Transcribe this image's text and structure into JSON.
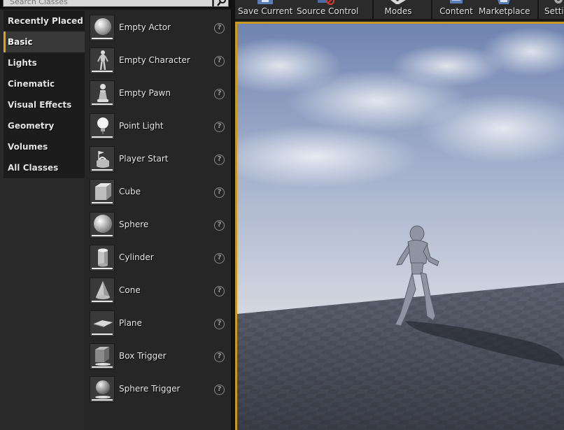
{
  "search": {
    "placeholder": "Search Classes"
  },
  "categories": [
    {
      "label": "Recently Placed"
    },
    {
      "label": "Basic",
      "active": true
    },
    {
      "label": "Lights"
    },
    {
      "label": "Cinematic"
    },
    {
      "label": "Visual Effects"
    },
    {
      "label": "Geometry"
    },
    {
      "label": "Volumes"
    },
    {
      "label": "All Classes"
    }
  ],
  "items": [
    {
      "label": "Empty Actor",
      "icon": "sphere-icon"
    },
    {
      "label": "Empty Character",
      "icon": "mannequin-icon"
    },
    {
      "label": "Empty Pawn",
      "icon": "pawn-icon"
    },
    {
      "label": "Point Light",
      "icon": "lightbulb-icon"
    },
    {
      "label": "Player Start",
      "icon": "player-start-icon"
    },
    {
      "label": "Cube",
      "icon": "cube-icon"
    },
    {
      "label": "Sphere",
      "icon": "sphere-icon"
    },
    {
      "label": "Cylinder",
      "icon": "cylinder-icon"
    },
    {
      "label": "Cone",
      "icon": "cone-icon"
    },
    {
      "label": "Plane",
      "icon": "plane-icon"
    },
    {
      "label": "Box Trigger",
      "icon": "box-trigger-icon"
    },
    {
      "label": "Sphere Trigger",
      "icon": "sphere-trigger-icon"
    }
  ],
  "help_glyph": "?",
  "toolbar": {
    "save_current": "Save Current",
    "source_control": "Source Control",
    "modes": "Modes",
    "content": "Content",
    "marketplace": "Marketplace",
    "settings": "Setti"
  },
  "colors": {
    "accent": "#e3a020",
    "viewport_border": "#c99a1f",
    "panel_bg": "#262626"
  }
}
